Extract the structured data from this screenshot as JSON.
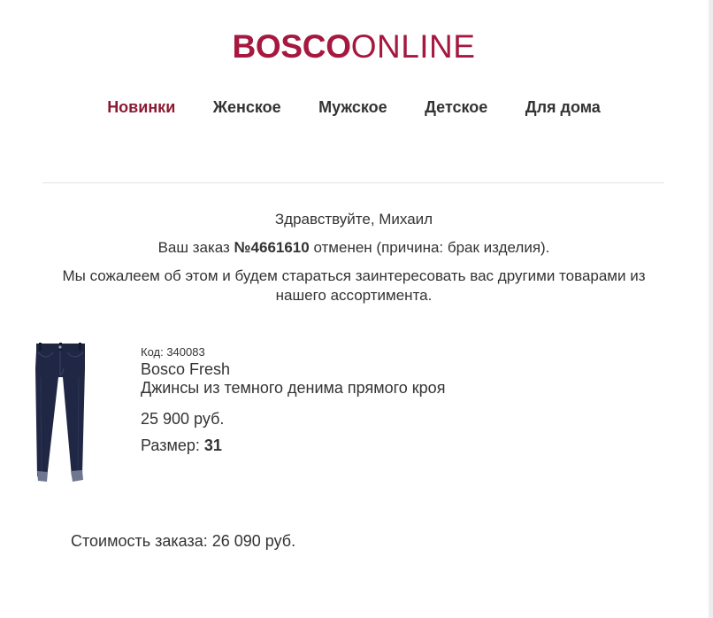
{
  "brand": {
    "logo_bold": "BOSCO",
    "logo_light": "ONLINE",
    "color": "#a5183f"
  },
  "nav": {
    "items": [
      {
        "label": "Новинки",
        "active": true
      },
      {
        "label": "Женское",
        "active": false
      },
      {
        "label": "Мужское",
        "active": false
      },
      {
        "label": "Детское",
        "active": false
      },
      {
        "label": "Для дома",
        "active": false
      }
    ],
    "active_color": "#8b1a32"
  },
  "message": {
    "greeting": "Здравствуйте, Михаил",
    "order_prefix": "Ваш заказ ",
    "order_number": "№4661610",
    "order_suffix": " отменен (причина: брак изделия).",
    "regret": "Мы сожалеем об этом и будем стараться заинтересовать вас другими товарами из нашего ассортимента."
  },
  "product": {
    "code": "Код: 340083",
    "brand": "Bosco Fresh",
    "title": "Джинсы из темного денима прямого кроя",
    "price": "25 900 руб.",
    "size_label": "Размер: ",
    "size_value": "31",
    "image_icon": "jeans-product-image"
  },
  "order": {
    "total": "Стоимость заказа: 26 090 руб."
  }
}
